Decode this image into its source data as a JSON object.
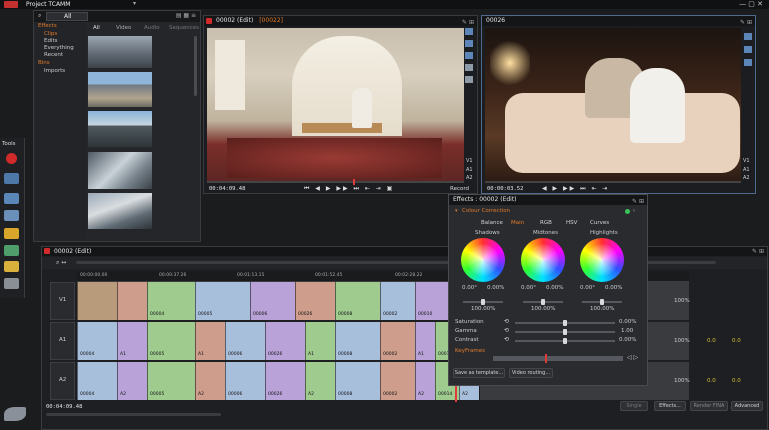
{
  "window": {
    "title": "Project TCAMM"
  },
  "bin": {
    "filter": "All",
    "tree": [
      "Effects",
      "Clips",
      "Edits",
      "Everything",
      "Recent",
      "Bins",
      "Imports"
    ],
    "tabs": [
      "All",
      "Video",
      "Audio",
      "Sequences"
    ]
  },
  "source_viewer": {
    "title": "00002 (Edit)",
    "subtitle": "[00022]",
    "timecode": "00:04:09.48",
    "record_label": "Record",
    "channels": [
      "V1",
      "A1",
      "A2"
    ]
  },
  "record_viewer": {
    "title": "00026",
    "timecode": "00:00:03.52",
    "channels": [
      "V1",
      "A1",
      "A2"
    ]
  },
  "tools": {
    "label": "Tools"
  },
  "effects": {
    "title": "Effects : 00002 (Edit)",
    "section": "Colour Correction",
    "tabs": [
      "Balance",
      "Main",
      "RGB",
      "HSV",
      "Curves"
    ],
    "wheels": [
      {
        "name": "Shadows",
        "v1": "0.00°",
        "v2": "0.00%",
        "pct": "100.00%"
      },
      {
        "name": "Midtones",
        "v1": "0.00°",
        "v2": "0.00%",
        "pct": "100.00%"
      },
      {
        "name": "Highlights",
        "v1": "0.00°",
        "v2": "0.00%",
        "pct": "100.00%"
      }
    ],
    "params": [
      {
        "name": "Saturation",
        "value": "0.00%"
      },
      {
        "name": "Gamma",
        "value": "1.00"
      },
      {
        "name": "Contrast",
        "value": "0.00%"
      }
    ],
    "keyframes_label": "KeyFrames",
    "save_button": "Save as template...",
    "video_routing_button": "Video routing..."
  },
  "timeline": {
    "title": "00002 (Edit)",
    "timecode": "00:04:09.48",
    "ruler": [
      "00:00:00.00",
      "00:00:37.26",
      "00:01:13.15",
      "00:01:52.45",
      "00:02:28.22"
    ],
    "tracks": [
      "V1",
      "A1",
      "A2"
    ],
    "v1_clips": [
      "00004",
      "00005",
      "00006",
      "00026",
      "00008",
      "00002",
      "00010"
    ],
    "a1_clips": [
      "00004",
      "A1",
      "00005",
      "A1",
      "00006",
      "00026",
      "A1",
      "00008",
      "00002",
      "A1",
      "00014",
      "A1"
    ],
    "a2_clips": [
      "00004",
      "A2",
      "00005",
      "A2",
      "00006",
      "00026",
      "A2",
      "00008",
      "00002",
      "A2",
      "00014",
      "A2"
    ],
    "levels": [
      "100%",
      "100%",
      "100%"
    ],
    "meter_values": [
      "0.0",
      "0.0",
      "0.0",
      "0.0"
    ],
    "bottom_buttons": [
      "Single",
      "Effects...",
      "Render FINA",
      "Advanced"
    ]
  }
}
